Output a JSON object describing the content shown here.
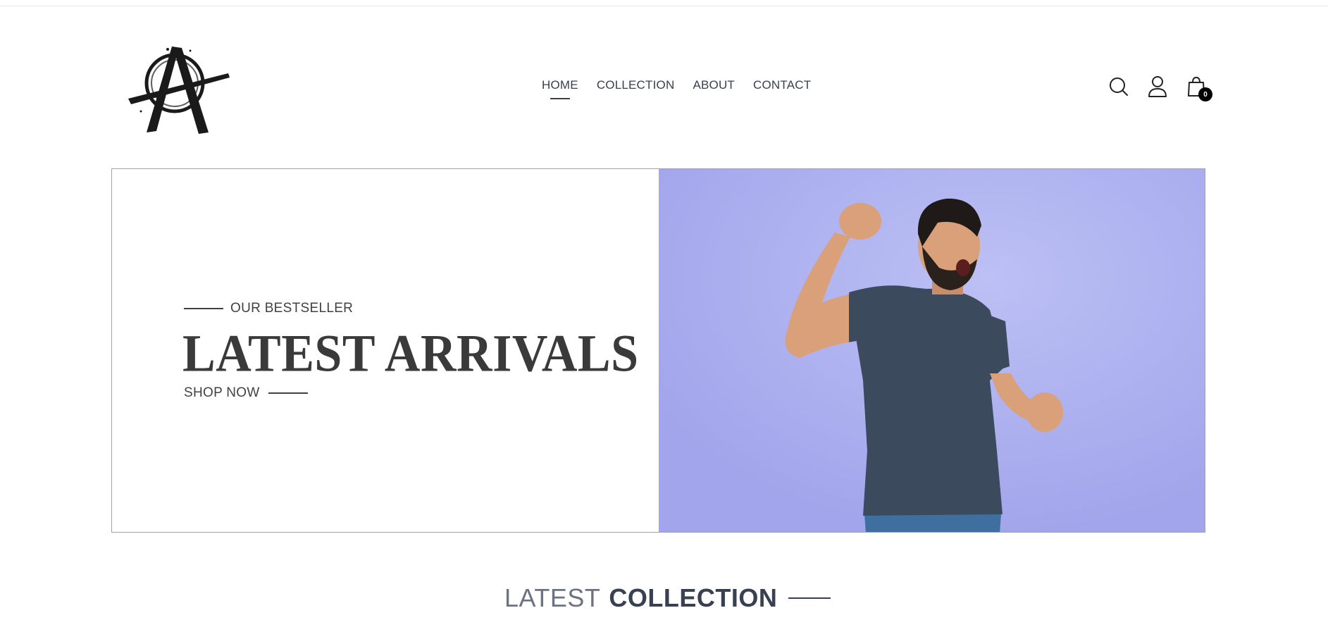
{
  "header": {
    "logo_icon": "anarchy-a-logo",
    "nav": [
      {
        "label": "HOME",
        "active": true
      },
      {
        "label": "COLLECTION",
        "active": false
      },
      {
        "label": "ABOUT",
        "active": false
      },
      {
        "label": "CONTACT",
        "active": false
      }
    ],
    "icons": [
      "search-icon",
      "user-icon",
      "shopping-bag-icon"
    ],
    "cart_count": "0"
  },
  "hero": {
    "eyebrow": "OUR BESTSELLER",
    "title": "LATEST ARRIVALS",
    "cta": "SHOP NOW",
    "image_subject": "man in grey t-shirt cheering",
    "image_bg_color": "#a9acef"
  },
  "section": {
    "title_light": "LATEST",
    "title_bold": "COLLECTION"
  },
  "colors": {
    "text": "#374151",
    "text_muted": "#6b7280",
    "accent_dark": "#000000",
    "border": "#9ca3af"
  }
}
